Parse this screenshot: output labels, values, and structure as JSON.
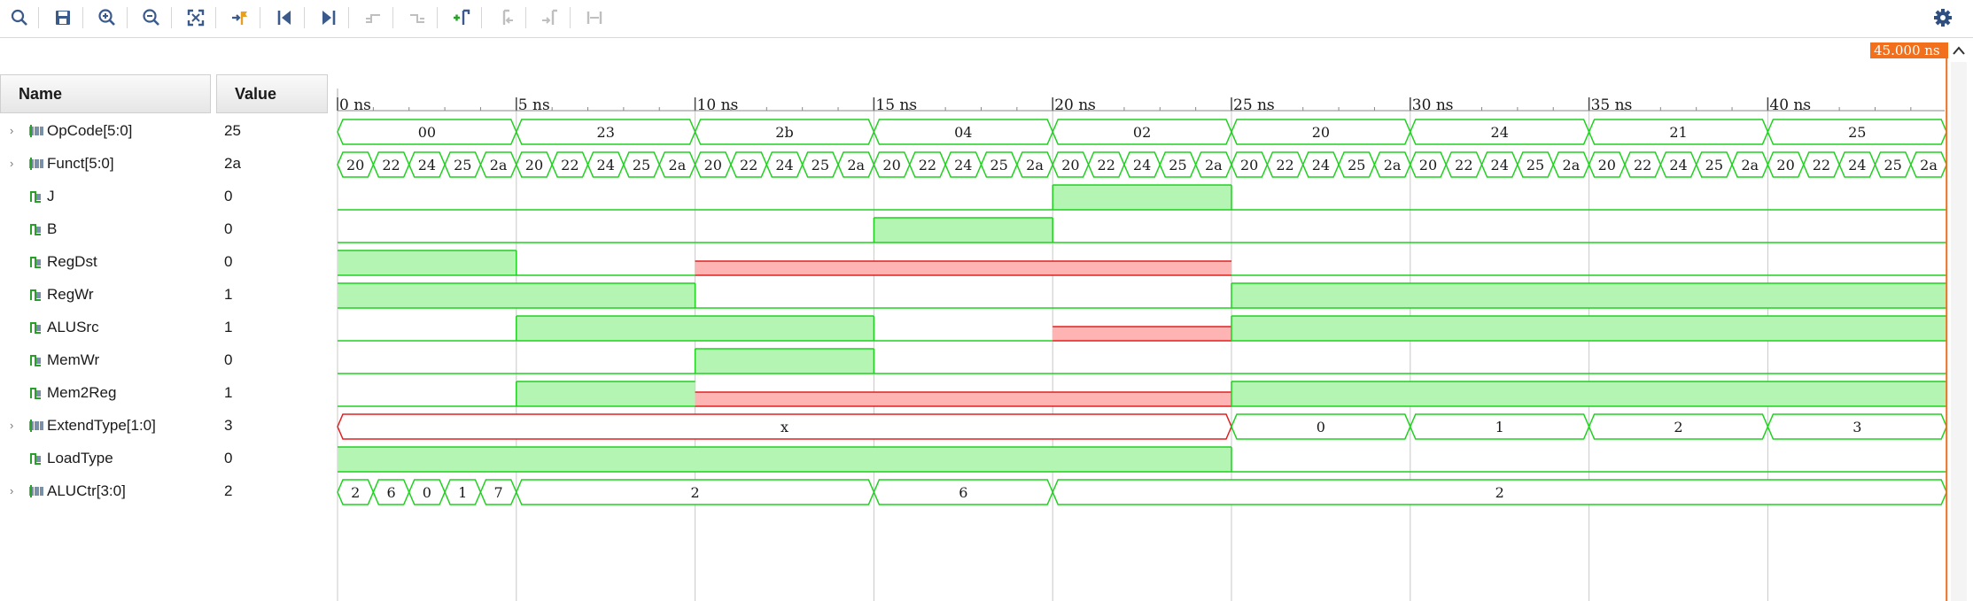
{
  "toolbar": {
    "buttons": [
      {
        "name": "search-icon"
      },
      {
        "name": "save-icon"
      },
      {
        "name": "zoom-in-icon"
      },
      {
        "name": "zoom-out-icon"
      },
      {
        "name": "zoom-fit-icon"
      },
      {
        "name": "go-to-cursor-icon"
      },
      {
        "name": "go-to-time-zero-icon"
      },
      {
        "name": "go-to-last-time-icon"
      },
      {
        "name": "previous-transition-icon"
      },
      {
        "name": "next-transition-icon"
      },
      {
        "name": "add-marker-icon"
      },
      {
        "name": "previous-marker-icon"
      },
      {
        "name": "next-marker-icon"
      },
      {
        "name": "swap-cursors-icon"
      }
    ],
    "settings_icon": "gear-icon"
  },
  "columns": {
    "name": "Name",
    "value": "Value"
  },
  "cursor": {
    "label": "45.000 ns",
    "time_ns": 45
  },
  "time_axis": {
    "ticks": [
      "0 ns",
      "5 ns",
      "10 ns",
      "15 ns",
      "20 ns",
      "25 ns",
      "30 ns",
      "35 ns",
      "40 ns"
    ],
    "step_ns": 5
  },
  "colors": {
    "wave": "#1ed11e",
    "high_fill": "#b4f5b4",
    "x_line": "#e02020",
    "x_fill": "#ffb4b4",
    "cursor": "#f26f1c"
  },
  "signals": [
    {
      "name": "OpCode[5:0]",
      "value": "25",
      "kind": "bus",
      "expandable": true,
      "segments": [
        [
          0,
          5,
          "00"
        ],
        [
          5,
          10,
          "23"
        ],
        [
          10,
          15,
          "2b"
        ],
        [
          15,
          20,
          "04"
        ],
        [
          20,
          25,
          "02"
        ],
        [
          25,
          30,
          "20"
        ],
        [
          30,
          35,
          "24"
        ],
        [
          35,
          40,
          "21"
        ],
        [
          40,
          45,
          "25"
        ]
      ]
    },
    {
      "name": "Funct[5:0]",
      "value": "2a",
      "kind": "bus",
      "expandable": true,
      "segments": [
        [
          0,
          1,
          "20"
        ],
        [
          1,
          2,
          "22"
        ],
        [
          2,
          3,
          "24"
        ],
        [
          3,
          4,
          "25"
        ],
        [
          4,
          5,
          "2a"
        ],
        [
          5,
          6,
          "20"
        ],
        [
          6,
          7,
          "22"
        ],
        [
          7,
          8,
          "24"
        ],
        [
          8,
          9,
          "25"
        ],
        [
          9,
          10,
          "2a"
        ],
        [
          10,
          11,
          "20"
        ],
        [
          11,
          12,
          "22"
        ],
        [
          12,
          13,
          "24"
        ],
        [
          13,
          14,
          "25"
        ],
        [
          14,
          15,
          "2a"
        ],
        [
          15,
          16,
          "20"
        ],
        [
          16,
          17,
          "22"
        ],
        [
          17,
          18,
          "24"
        ],
        [
          18,
          19,
          "25"
        ],
        [
          19,
          20,
          "2a"
        ],
        [
          20,
          21,
          "20"
        ],
        [
          21,
          22,
          "22"
        ],
        [
          22,
          23,
          "24"
        ],
        [
          23,
          24,
          "25"
        ],
        [
          24,
          25,
          "2a"
        ],
        [
          25,
          26,
          "20"
        ],
        [
          26,
          27,
          "22"
        ],
        [
          27,
          28,
          "24"
        ],
        [
          28,
          29,
          "25"
        ],
        [
          29,
          30,
          "2a"
        ],
        [
          30,
          31,
          "20"
        ],
        [
          31,
          32,
          "22"
        ],
        [
          32,
          33,
          "24"
        ],
        [
          33,
          34,
          "25"
        ],
        [
          34,
          35,
          "2a"
        ],
        [
          35,
          36,
          "20"
        ],
        [
          36,
          37,
          "22"
        ],
        [
          37,
          38,
          "24"
        ],
        [
          38,
          39,
          "25"
        ],
        [
          39,
          40,
          "2a"
        ],
        [
          40,
          41,
          "20"
        ],
        [
          41,
          42,
          "22"
        ],
        [
          42,
          43,
          "24"
        ],
        [
          43,
          44,
          "25"
        ],
        [
          44,
          45,
          "2a"
        ]
      ]
    },
    {
      "name": "J",
      "value": "0",
      "kind": "bit",
      "expandable": false,
      "segments": [
        [
          0,
          20,
          "0"
        ],
        [
          20,
          25,
          "1"
        ],
        [
          25,
          45,
          "0"
        ]
      ]
    },
    {
      "name": "B",
      "value": "0",
      "kind": "bit",
      "expandable": false,
      "segments": [
        [
          0,
          15,
          "0"
        ],
        [
          15,
          20,
          "1"
        ],
        [
          20,
          45,
          "0"
        ]
      ]
    },
    {
      "name": "RegDst",
      "value": "0",
      "kind": "bit",
      "expandable": false,
      "segments": [
        [
          0,
          5,
          "1"
        ],
        [
          5,
          10,
          "0"
        ],
        [
          10,
          25,
          "X"
        ],
        [
          25,
          45,
          "0"
        ]
      ]
    },
    {
      "name": "RegWr",
      "value": "1",
      "kind": "bit",
      "expandable": false,
      "segments": [
        [
          0,
          10,
          "1"
        ],
        [
          10,
          25,
          "0"
        ],
        [
          25,
          45,
          "1"
        ]
      ]
    },
    {
      "name": "ALUSrc",
      "value": "1",
      "kind": "bit",
      "expandable": false,
      "segments": [
        [
          0,
          5,
          "0"
        ],
        [
          5,
          15,
          "1"
        ],
        [
          15,
          20,
          "0"
        ],
        [
          20,
          25,
          "X"
        ],
        [
          25,
          45,
          "1"
        ]
      ]
    },
    {
      "name": "MemWr",
      "value": "0",
      "kind": "bit",
      "expandable": false,
      "segments": [
        [
          0,
          10,
          "0"
        ],
        [
          10,
          15,
          "1"
        ],
        [
          15,
          45,
          "0"
        ]
      ]
    },
    {
      "name": "Mem2Reg",
      "value": "1",
      "kind": "bit",
      "expandable": false,
      "segments": [
        [
          0,
          5,
          "0"
        ],
        [
          5,
          10,
          "1"
        ],
        [
          10,
          25,
          "X"
        ],
        [
          25,
          45,
          "1"
        ]
      ]
    },
    {
      "name": "ExtendType[1:0]",
      "value": "3",
      "kind": "bus",
      "expandable": true,
      "segments": [
        [
          0,
          25,
          "X"
        ],
        [
          25,
          30,
          "0"
        ],
        [
          30,
          35,
          "1"
        ],
        [
          35,
          40,
          "2"
        ],
        [
          40,
          45,
          "3"
        ]
      ]
    },
    {
      "name": "LoadType",
      "value": "0",
      "kind": "bit",
      "expandable": false,
      "segments": [
        [
          0,
          25,
          "1"
        ],
        [
          25,
          45,
          "0"
        ]
      ]
    },
    {
      "name": "ALUCtr[3:0]",
      "value": "2",
      "kind": "bus",
      "expandable": true,
      "segments": [
        [
          0,
          1,
          "2"
        ],
        [
          1,
          2,
          "6"
        ],
        [
          2,
          3,
          "0"
        ],
        [
          3,
          4,
          "1"
        ],
        [
          4,
          5,
          "7"
        ],
        [
          5,
          15,
          "2"
        ],
        [
          15,
          20,
          "6"
        ],
        [
          20,
          45,
          "2"
        ]
      ]
    }
  ]
}
